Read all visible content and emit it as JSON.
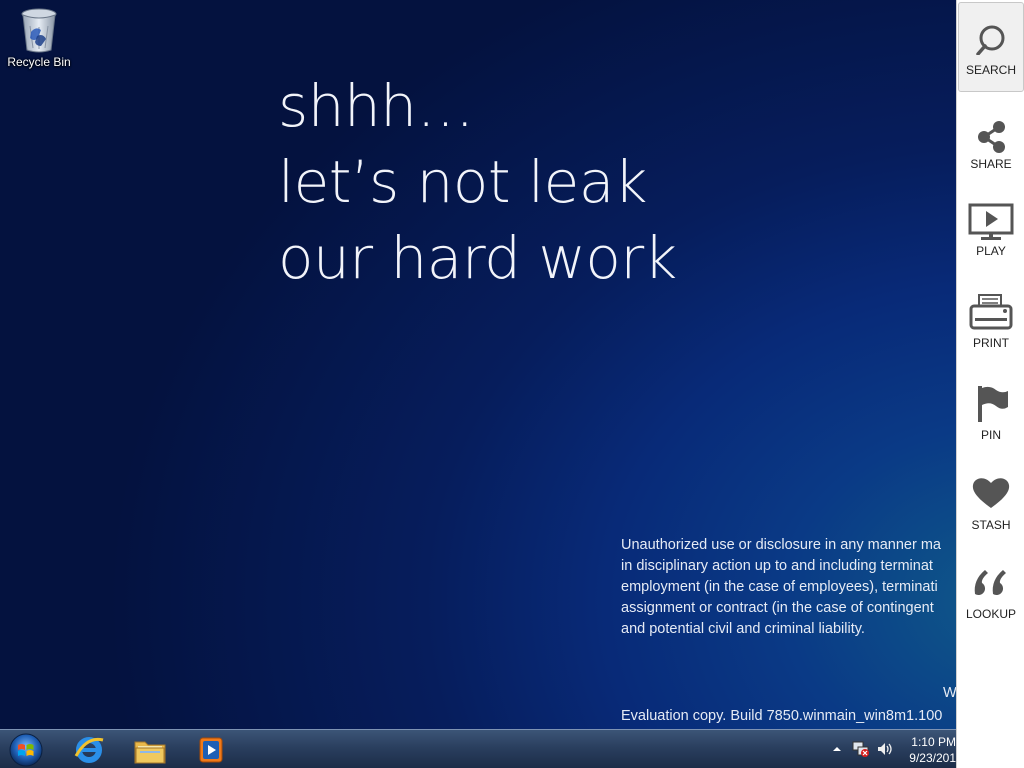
{
  "desktop": {
    "icons": [
      {
        "label": "Recycle Bin",
        "icon": "recycle-bin-icon"
      }
    ]
  },
  "headline": {
    "lines": [
      "shhh…",
      "let’s not leak",
      "our hard work"
    ]
  },
  "legal": {
    "lines": [
      "Unauthorized use or disclosure in any manner ma",
      "in disciplinary action up to and including terminat",
      "employment (in the case of employees), terminati",
      "assignment or contract (in the case of contingent",
      "and potential civil and criminal liability."
    ]
  },
  "watermark": {
    "edition": "W",
    "build": "Evaluation copy. Build 7850.winmain_win8m1.100"
  },
  "charms": [
    {
      "label": "SEARCH",
      "icon": "search-icon",
      "active": true
    },
    {
      "label": "SHARE",
      "icon": "share-icon"
    },
    {
      "label": "PLAY",
      "icon": "play-icon"
    },
    {
      "label": "PRINT",
      "icon": "print-icon"
    },
    {
      "label": "PIN",
      "icon": "pin-flag-icon"
    },
    {
      "label": "STASH",
      "icon": "heart-icon"
    },
    {
      "label": "LOOKUP",
      "icon": "quote-icon"
    }
  ],
  "taskbar": {
    "start": {
      "icon": "windows-start-icon"
    },
    "apps": [
      {
        "name": "Internet Explorer",
        "icon": "internet-explorer-icon"
      },
      {
        "name": "Windows Explorer",
        "icon": "file-explorer-icon"
      },
      {
        "name": "Windows Media Player",
        "icon": "media-player-icon"
      }
    ],
    "tray": {
      "time": "1:10 PM",
      "date": "9/23/201",
      "icons": [
        "show-hidden-icons-arrow-icon",
        "network-icon",
        "volume-icon"
      ]
    }
  },
  "colors": {
    "desktop_top": "#04123f",
    "desktop_glow": "#0f5a8a",
    "charms_bg": "#ffffff",
    "charm_icon": "#555555"
  }
}
